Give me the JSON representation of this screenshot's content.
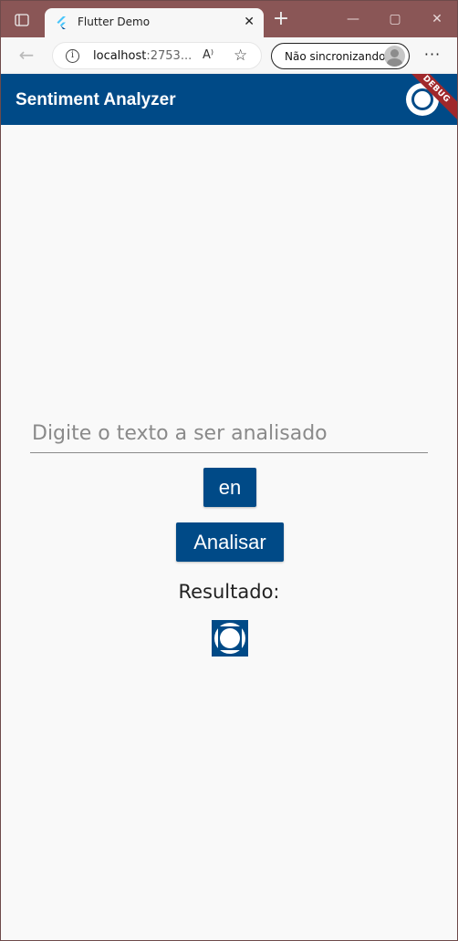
{
  "browser": {
    "tab_title": "Flutter Demo",
    "tab_close_glyph": "✕",
    "new_tab_glyph": "+",
    "url_host": "localhost",
    "url_rest": ":2753...",
    "read_aloud_glyph": "A⁾",
    "favorite_glyph": "☆",
    "profile_label": "Não sincronizando",
    "more_glyph": "···",
    "back_glyph": "←",
    "info_glyph": "i",
    "window_controls": {
      "minimize": "—",
      "maximize": "▢",
      "close": "✕"
    }
  },
  "app": {
    "title": "Sentiment Analyzer",
    "debug_banner": "DEBUG",
    "accent_color": "#004a87",
    "debug_color": "#a0282b"
  },
  "form": {
    "input_placeholder": "Digite o texto a ser analisado",
    "input_value": "",
    "language_button": "en",
    "analyze_button": "Analisar",
    "result_label": "Resultado:"
  },
  "icons": {
    "browser_tab_actions": "tab-actions-icon",
    "favicon": "flutter-icon",
    "appbar_icon": "placeholder-image-icon",
    "result_icon": "placeholder-image-icon"
  }
}
